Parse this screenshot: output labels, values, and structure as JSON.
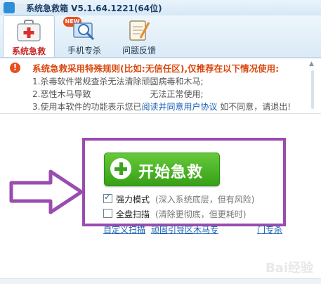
{
  "titlebar": {
    "title": "系统急救箱 V5.1.64.1221(64位)"
  },
  "tabs": [
    {
      "label": "系统急救",
      "icon": "first-aid-kit-icon",
      "active": true
    },
    {
      "label": "手机专杀",
      "icon": "phone-scan-icon",
      "badge": "NEW"
    },
    {
      "label": "问题反馈",
      "icon": "feedback-notepad-icon"
    }
  ],
  "notice": {
    "headline": "系统急救采用特殊规则(比如:无信任区),仅推荐在以下情况使用:",
    "item1": "1.杀毒软件常规查杀无法清除顽固病毒和木马;",
    "item2_prefix": "2.恶性木马导致",
    "item2_suffix": "无法正常使用;",
    "item3_prefix": "3.使用本软件的功能表示您已",
    "item3_link": "阅读并同意用户协议",
    "item3_suffix": " 如不同意，请退出!"
  },
  "main": {
    "start_button": "开始急救",
    "option1": {
      "label": "强力模式",
      "hint": "(深入系统底层，但有风险)",
      "checked": true
    },
    "option2": {
      "label": "全盘扫描",
      "hint": "(清除更彻底，但更耗时)",
      "checked": false
    }
  },
  "footer": {
    "link1": "自定义扫描",
    "link2": "顽固引导区木马专",
    "link3": "门专杀"
  },
  "watermark": {
    "text": "Bai经验"
  },
  "colors": {
    "accent_red": "#c62828",
    "start_green": "#3aa51c",
    "highlight_purple": "#9a4cb0",
    "link_blue": "#1a5fb4"
  }
}
